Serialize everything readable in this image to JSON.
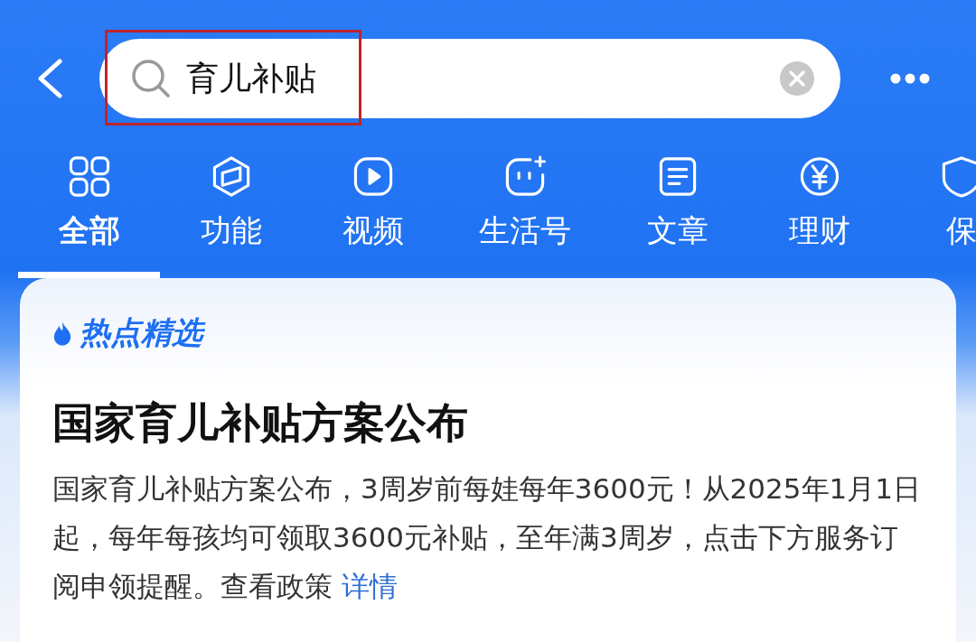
{
  "search": {
    "value": "育儿补贴",
    "highlighted": true
  },
  "tabs": [
    {
      "label": "全部",
      "kind": "grid",
      "selected": true
    },
    {
      "label": "功能",
      "kind": "cube",
      "selected": false
    },
    {
      "label": "视频",
      "kind": "play",
      "selected": false
    },
    {
      "label": "生活号",
      "kind": "face",
      "selected": false
    },
    {
      "label": "文章",
      "kind": "doc",
      "selected": false
    },
    {
      "label": "理财",
      "kind": "yen",
      "selected": false
    },
    {
      "label": "保",
      "kind": "shield",
      "selected": false
    }
  ],
  "card": {
    "badge": "热点精选",
    "title": "国家育儿补贴方案公布",
    "description": "国家育儿补贴方案公布，3周岁前每娃每年3600元！从2025年1月1日起，每年每孩均可领取3600元补贴，至年满3周岁，点击下方服务订阅申领提醒。查看政策",
    "link": "详情"
  }
}
